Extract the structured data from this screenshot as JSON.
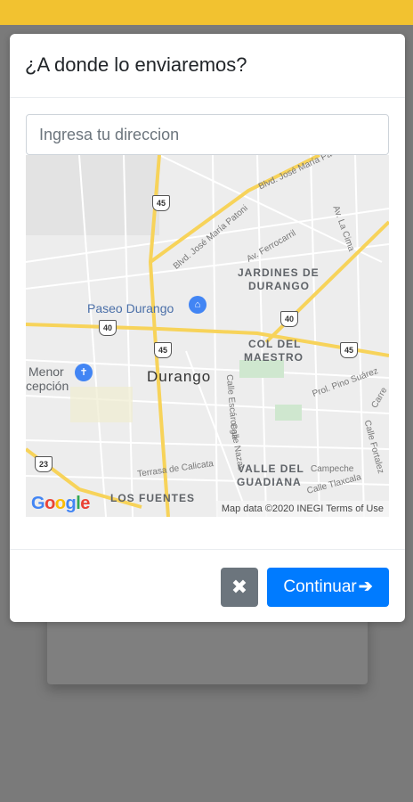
{
  "colors": {
    "topbar": "#f2c230",
    "overlay": "#7a7a7a",
    "primary": "#007bff",
    "secondary": "#6c757d"
  },
  "modal": {
    "title": "¿A donde lo enviaremos?",
    "address_placeholder": "Ingresa tu direccion",
    "close_icon": "times-icon",
    "close_glyph": "✖",
    "continue_label": "Continuar",
    "continue_icon": "arrow-right-icon",
    "continue_glyph": "➔"
  },
  "map": {
    "labels": {
      "jardines_1": "JARDINES DE",
      "jardines_2": "DURANGO",
      "col_1": "COL DEL",
      "col_2": "MAESTRO",
      "city": "Durango",
      "paseo": "Paseo Durango",
      "menor": "Menor",
      "cepcion": "cepción",
      "valle_1": "VALLE DEL",
      "valle_2": "GUADIANA",
      "fuentes": "LOS FUENTES",
      "blvd_jose_maria": "Blvd. José María Patoni",
      "av_ferrocarril": "Av. Ferrocarril",
      "av_la_cima": "Av. La Cima",
      "blvd_jose_maria_pa": "Blvd. José María Pa",
      "prol_pino": "Prol. Pino Suárez",
      "terrasa_calicata": "Terrasa de Calicata",
      "campeche": "Campeche",
      "calle_tlaxcala": "Calle Tlaxcala",
      "calle_nazas": "Calle Nazas",
      "calle_esc": "Calle Escárcega",
      "calle_fortalez": "Calle Fortalez",
      "carre": "Carre"
    },
    "shields": {
      "s45a": "45",
      "s40a": "40",
      "s45b": "45",
      "s40b": "40",
      "s45c": "45",
      "s23": "23"
    },
    "google": "Google",
    "footer": "Map data ©2020 INEGI    Terms of Use"
  }
}
